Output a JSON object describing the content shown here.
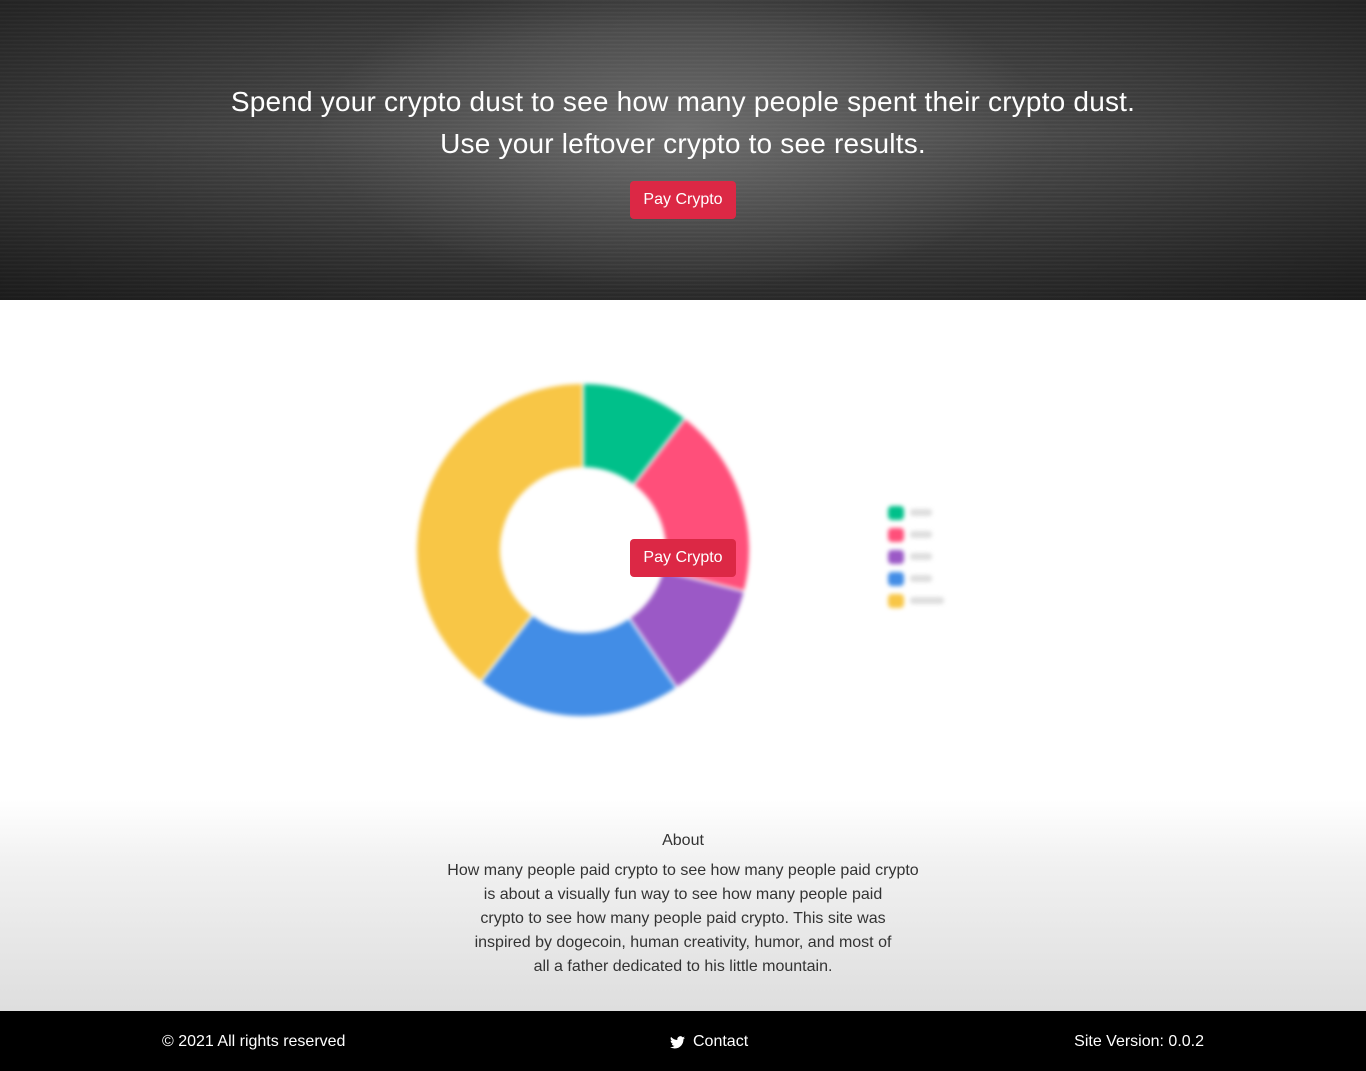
{
  "hero": {
    "line1": "Spend your crypto dust to see how many people spent their crypto dust.",
    "line2": "Use your leftover crypto to see results.",
    "pay_button": "Pay Crypto"
  },
  "overlay": {
    "pay_button": "Pay Crypto"
  },
  "chart_data": {
    "type": "pie",
    "donut": true,
    "categories": [
      "",
      "",
      "",
      "",
      ""
    ],
    "values": [
      10.5,
      18.5,
      11.5,
      20.0,
      39.5
    ],
    "colors": [
      "#00c08a",
      "#ff4f7a",
      "#9b59c6",
      "#428de6",
      "#f8c646"
    ],
    "legend_position": "right"
  },
  "about": {
    "title": "About",
    "lines": [
      "How many people paid crypto to see how many people paid crypto",
      "is about a visually fun way to see how many people paid",
      "crypto to see how many people paid crypto. This site was",
      "inspired by dogecoin, human creativity, humor, and most of",
      "all a father dedicated to his little mountain."
    ]
  },
  "footer": {
    "copyright": "© 2021 All rights reserved",
    "contact": "Contact",
    "contact_icon": "twitter-icon",
    "version": "Site Version: 0.0.2"
  }
}
